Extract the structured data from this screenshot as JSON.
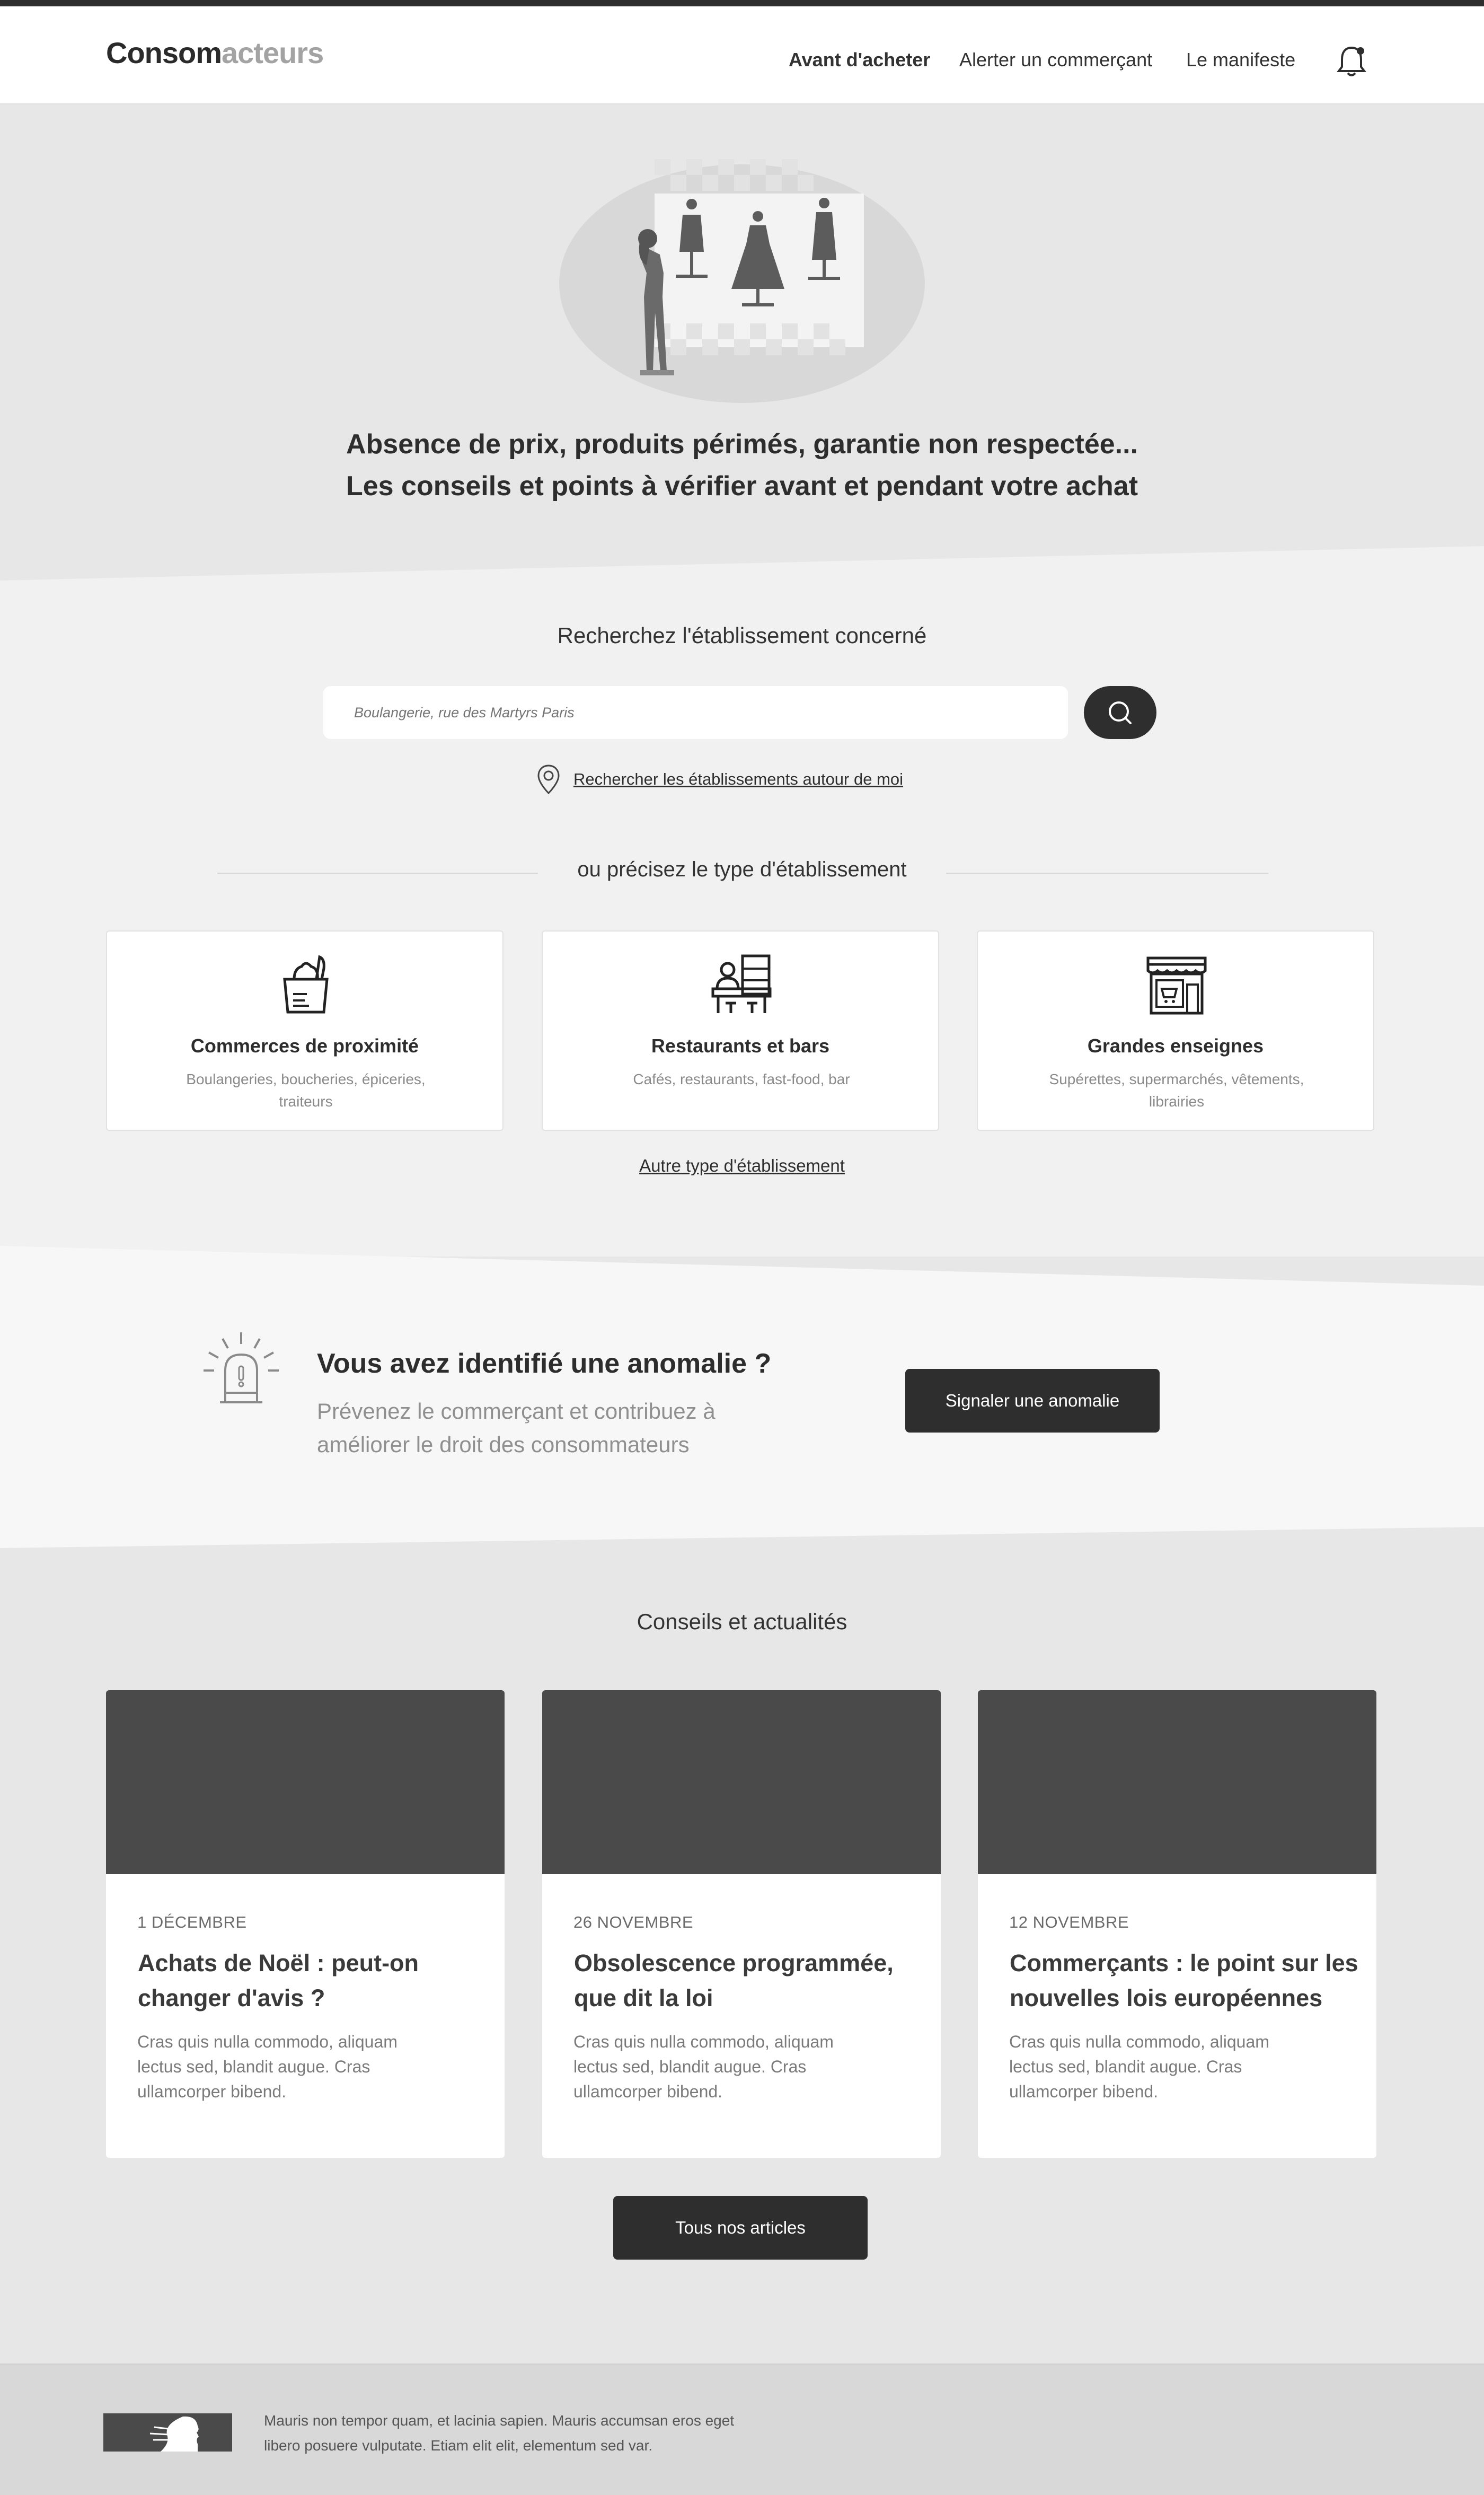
{
  "header": {
    "logo_dark": "Consom",
    "logo_light": "acteurs",
    "nav": [
      "Avant d'acheter",
      "Alerter un commerçant",
      "Le manifeste"
    ]
  },
  "hero": {
    "line1": "Absence de prix, produits périmés, garantie non respectée...",
    "line2": "Les conseils et points à vérifier avant  et pendant votre achat"
  },
  "search": {
    "label": "Recherchez l'établissement concerné",
    "placeholder": "Boulangerie, rue des Martyrs Paris",
    "nearby": "Rechercher les établissements autour de moi"
  },
  "types": {
    "divider": "ou précisez le type d'établissement",
    "cards": [
      {
        "title": "Commerces de proximité",
        "sub": "Boulangeries, boucheries, épiceries, traiteurs",
        "icon": "grocery-bag-icon"
      },
      {
        "title": "Restaurants et bars",
        "sub": "Cafés, restaurants, fast-food, bar",
        "icon": "bar-counter-icon"
      },
      {
        "title": "Grandes enseignes",
        "sub": "Supérettes, supermarchés, vêtements, librairies",
        "icon": "storefront-icon"
      }
    ],
    "other": "Autre type d'établissement"
  },
  "anomaly": {
    "title": "Vous avez identifié une anomalie ?",
    "text": "Prévenez le commerçant et contribuez à améliorer le droit des consommateurs",
    "button": "Signaler une anomalie"
  },
  "news": {
    "title": "Conseils et actualités",
    "articles": [
      {
        "date": "1 DÉCEMBRE",
        "title": "Achats de Noël : peut-on changer d'avis ?",
        "excerpt": "Cras quis nulla commodo, aliquam lectus sed, blandit augue. Cras ullamcorper bibend."
      },
      {
        "date": "26 NOVEMBRE",
        "title": "Obsolescence programmée, que dit la loi",
        "excerpt": "Cras quis nulla commodo, aliquam lectus sed, blandit augue. Cras ullamcorper bibend."
      },
      {
        "date": "12 NOVEMBRE",
        "title": "Commerçants : le point sur les nouvelles lois européennes",
        "excerpt": "Cras quis nulla commodo, aliquam lectus sed, blandit augue. Cras ullamcorper bibend."
      }
    ],
    "button": "Tous nos articles"
  },
  "footer": {
    "text": "Mauris non tempor quam, et lacinia sapien. Mauris accumsan eros eget libero posuere vulputate. Etiam elit elit, elementum sed var."
  },
  "colors": {
    "dark": "#2e2e2e",
    "background": "#e7e7e7",
    "card": "#ffffff",
    "image_placeholder": "#4a4a4a"
  }
}
